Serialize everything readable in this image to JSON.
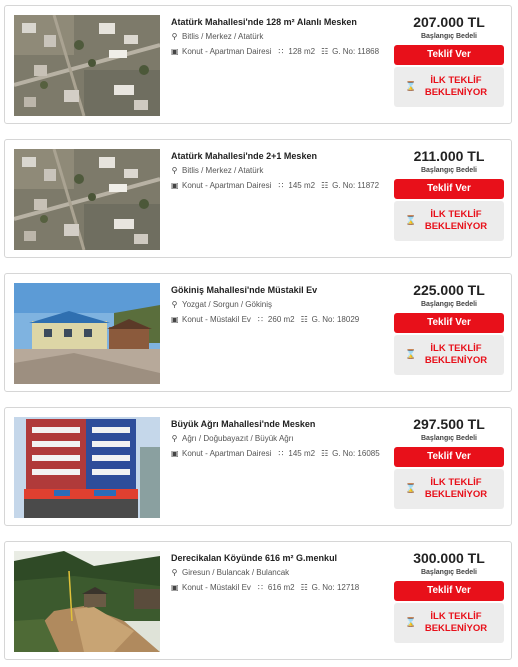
{
  "colors": {
    "accent": "#e8101a",
    "border": "#d6d6d6",
    "wait_bg": "#ececec"
  },
  "icons": {
    "location": "map-pin-icon",
    "type": "building-icon",
    "area": "area-icon",
    "id": "id-icon",
    "waiting": "hourglass-icon"
  },
  "listings": [
    {
      "title": "Atatürk Mahallesi'nde 128 m² Alanlı Mesken",
      "location": "Bitlis / Merkez / Atatürk",
      "type": "Konut - Apartman Dairesi",
      "area": "128 m2",
      "gno_label": "G. No:",
      "gno": "11868",
      "price": "207.000 TL",
      "price_label": "Başlangıç Bedeli",
      "offer_button": "Teklif Ver",
      "waiting_line1": "İLK TEKLİF",
      "waiting_line2": "BEKLENİYOR",
      "photo": "aerial"
    },
    {
      "title": "Atatürk Mahallesi'nde 2+1 Mesken",
      "location": "Bitlis / Merkez / Atatürk",
      "type": "Konut - Apartman Dairesi",
      "area": "145 m2",
      "gno_label": "G. No:",
      "gno": "11872",
      "price": "211.000 TL",
      "price_label": "Başlangıç Bedeli",
      "offer_button": "Teklif Ver",
      "waiting_line1": "İLK TEKLİF",
      "waiting_line2": "BEKLENİYOR",
      "photo": "aerial"
    },
    {
      "title": "Gökiniş Mahallesi'nde Müstakil Ev",
      "location": "Yozgat / Sorgun / Gökiniş",
      "type": "Konut - Müstakil Ev",
      "area": "260 m2",
      "gno_label": "G. No:",
      "gno": "18029",
      "price": "225.000 TL",
      "price_label": "Başlangıç Bedeli",
      "offer_button": "Teklif Ver",
      "waiting_line1": "İLK TEKLİF",
      "waiting_line2": "BEKLENİYOR",
      "photo": "house"
    },
    {
      "title": "Büyük Ağrı Mahallesi'nde Mesken",
      "location": "Ağrı / Doğubayazıt / Büyük Ağrı",
      "type": "Konut - Apartman Dairesi",
      "area": "145 m2",
      "gno_label": "G. No:",
      "gno": "16085",
      "price": "297.500 TL",
      "price_label": "Başlangıç Bedeli",
      "offer_button": "Teklif Ver",
      "waiting_line1": "İLK TEKLİF",
      "waiting_line2": "BEKLENİYOR",
      "photo": "apartment"
    },
    {
      "title": "Derecikalan Köyünde 616 m² G.menkul",
      "location": "Giresun / Bulancak / Bulancak",
      "type": "Konut - Müstakil Ev",
      "area": "616 m2",
      "gno_label": "G. No:",
      "gno": "12718",
      "price": "300.000 TL",
      "price_label": "Başlangıç Bedeli",
      "offer_button": "Teklif Ver",
      "waiting_line1": "İLK TEKLİF",
      "waiting_line2": "BEKLENİYOR",
      "photo": "forest"
    }
  ]
}
